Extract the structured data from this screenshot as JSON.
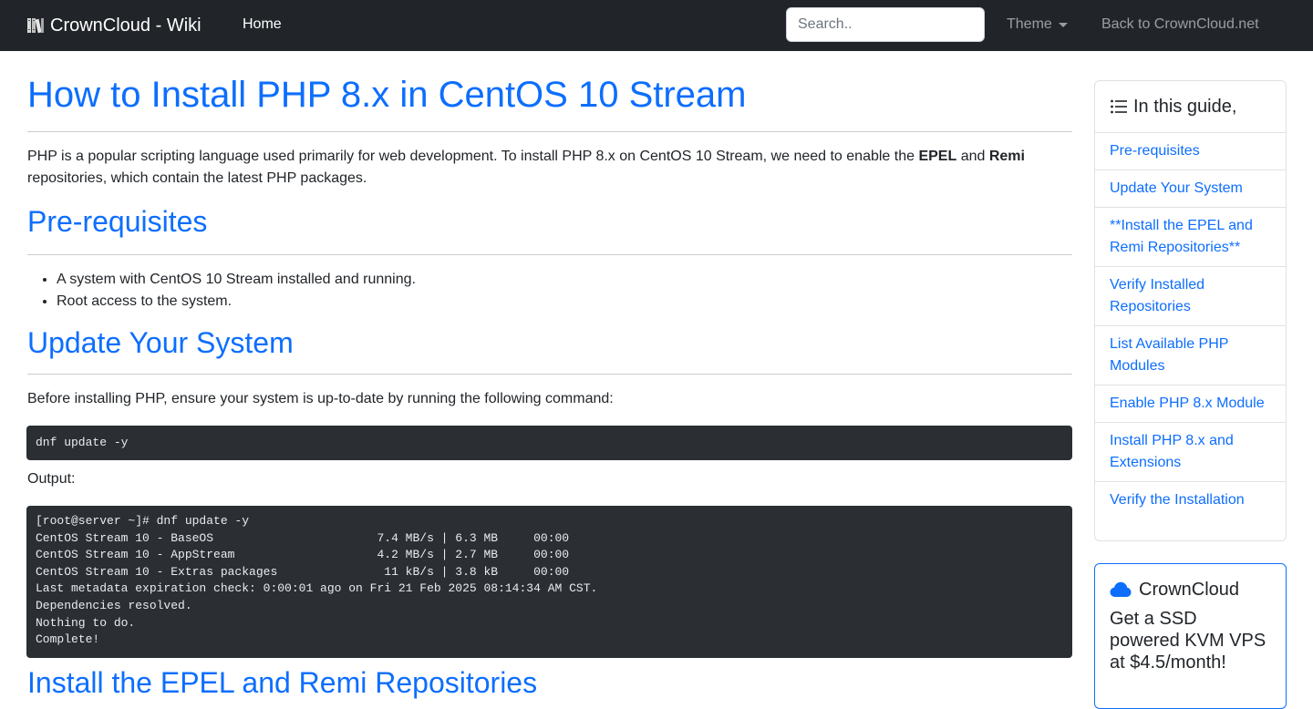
{
  "navbar": {
    "brand": "CrownCloud - Wiki",
    "home": "Home",
    "search_placeholder": "Search..",
    "theme": "Theme",
    "back": "Back to CrownCloud.net"
  },
  "article": {
    "title": "How to Install PHP 8.x in CentOS 10 Stream",
    "intro_part1": "PHP is a popular scripting language used primarily for web development. To install PHP 8.x on CentOS 10 Stream, we need to enable the ",
    "intro_epel": "EPEL",
    "intro_and": " and ",
    "intro_remi": "Remi",
    "intro_part2": " repositories, which contain the latest PHP packages.",
    "prereq_heading": "Pre-requisites",
    "prereq_items": [
      "A system with CentOS 10 Stream installed and running.",
      "Root access to the system."
    ],
    "update_heading": "Update Your System",
    "update_text": "Before installing PHP, ensure your system is up-to-date by running the following command:",
    "update_cmd": "dnf update -y",
    "output_label": "Output:",
    "output_block": "[root@server ~]# dnf update -y\nCentOS Stream 10 - BaseOS                       7.4 MB/s | 6.3 MB     00:00\nCentOS Stream 10 - AppStream                    4.2 MB/s | 2.7 MB     00:00\nCentOS Stream 10 - Extras packages               11 kB/s | 3.8 kB     00:00\nLast metadata expiration check: 0:00:01 ago on Fri 21 Feb 2025 08:14:34 AM CST.\nDependencies resolved.\nNothing to do.\nComplete!",
    "epel_heading": "Install the EPEL and Remi Repositories"
  },
  "toc": {
    "heading": "In this guide,",
    "items": [
      "Pre-requisites",
      "Update Your System",
      "**Install the EPEL and Remi Repositories**",
      "Verify Installed Repositories",
      "List Available PHP Modules",
      "Enable PHP 8.x Module",
      "Install PHP 8.x and Extensions",
      "Verify the Installation"
    ]
  },
  "ad": {
    "title": "CrownCloud",
    "text": "Get a SSD powered KVM VPS at $4.5/month!"
  },
  "colors": {
    "navbar_bg": "#212529",
    "link": "#0d6efd",
    "code_bg": "#2b2f33"
  }
}
